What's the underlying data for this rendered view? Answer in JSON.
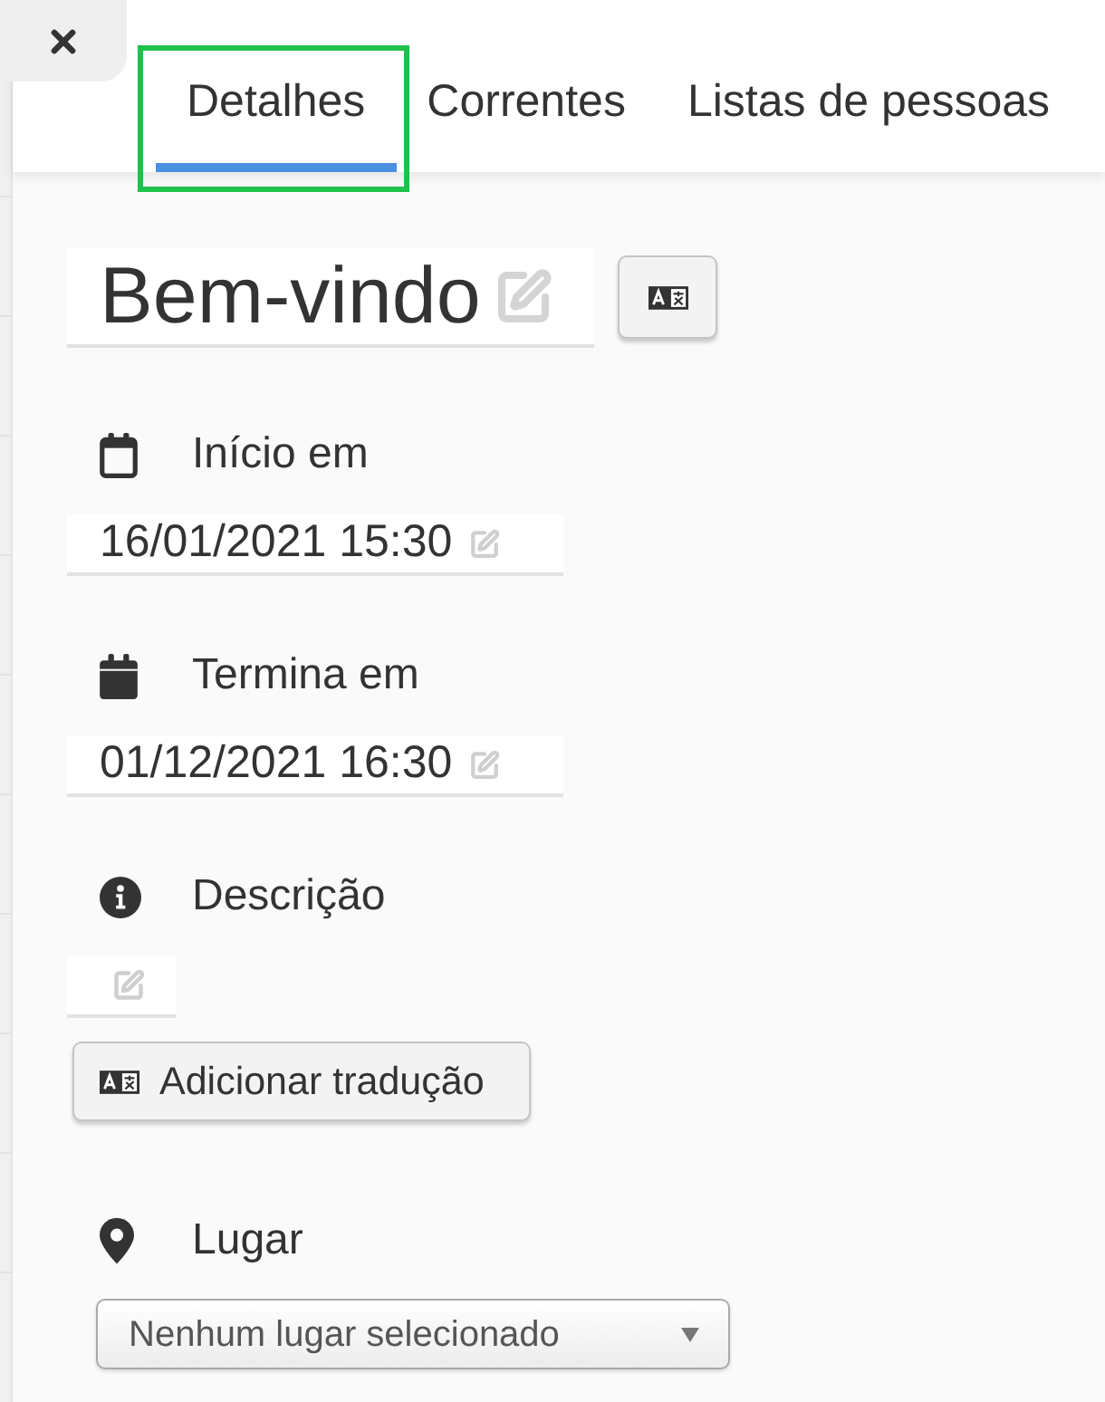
{
  "tabs": [
    {
      "label": "Detalhes",
      "selected": true,
      "highlighted": true
    },
    {
      "label": "Correntes",
      "selected": false,
      "highlighted": false
    },
    {
      "label": "Listas de pessoas",
      "selected": false,
      "highlighted": false
    }
  ],
  "title": {
    "value": "Bem-vindo"
  },
  "fields": [
    {
      "kind": "start",
      "label": "Início em",
      "value": "16/01/2021 15:30"
    },
    {
      "kind": "end",
      "label": "Termina em",
      "value": "01/12/2021 16:30"
    },
    {
      "kind": "description",
      "label": "Descrição",
      "button": "Adicionar tradução"
    },
    {
      "kind": "place",
      "label": "Lugar",
      "select": "Nenhum lugar selecionado"
    }
  ]
}
